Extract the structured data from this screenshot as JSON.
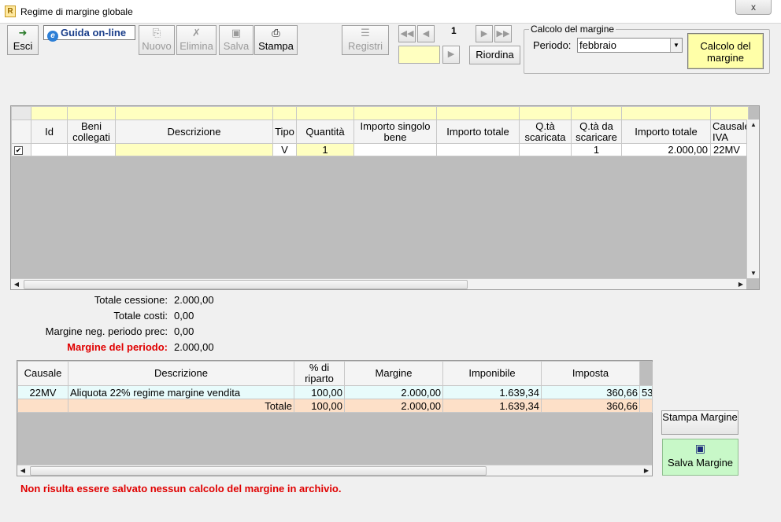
{
  "window": {
    "title": "Regime di margine globale",
    "app_icon": "R",
    "close_label": "x"
  },
  "toolbar": {
    "esci": "Esci",
    "guida": "Guida on-line",
    "nuovo": "Nuovo",
    "elimina": "Elimina",
    "salva": "Salva",
    "stampa": "Stampa",
    "registri": "Registri",
    "page_number": "1",
    "goto_value": "",
    "riordina": "Riordina"
  },
  "calcolo": {
    "title": "Calcolo del margine",
    "periodo_label": "Periodo:",
    "periodo_value": "febbraio",
    "button": "Calcolo del margine"
  },
  "grid": {
    "columns": [
      "Id",
      "Beni collegati",
      "Descrizione",
      "Tipo",
      "Quantità",
      "Importo singolo bene",
      "Importo totale",
      "Q.tà scaricata",
      "Q.tà da scaricare",
      "Importo totale",
      "Causale IVA"
    ],
    "rows": [
      {
        "checked": true,
        "id": "",
        "beni": "",
        "descrizione": "",
        "tipo": "V",
        "quantita": "1",
        "importo_singolo": "",
        "importo_totale": "",
        "qta_scaricata": "",
        "qta_da_scaricare": "1",
        "importo_totale2": "2.000,00",
        "causale": "22MV"
      }
    ]
  },
  "summary": {
    "totale_cessione_label": "Totale cessione:",
    "totale_cessione": "2.000,00",
    "totale_costi_label": "Totale costi:",
    "totale_costi": "0,00",
    "margine_neg_label": "Margine neg. periodo prec:",
    "margine_neg": "0,00",
    "margine_periodo_label": "Margine del periodo:",
    "margine_periodo": "2.000,00"
  },
  "grid2": {
    "columns": [
      "Causale",
      "Descrizione",
      "% di riparto",
      "Margine",
      "Imponibile",
      "Imposta"
    ],
    "rows": [
      {
        "causale": "22MV",
        "descrizione": "Aliquota 22% regime margine vendita",
        "riparto": "100,00",
        "margine": "2.000,00",
        "imponibile": "1.639,34",
        "imposta": "360,66",
        "extra": "53"
      }
    ],
    "total": {
      "label": "Totale",
      "riparto": "100,00",
      "margine": "2.000,00",
      "imponibile": "1.639,34",
      "imposta": "360,66"
    }
  },
  "side": {
    "stampa_margine": "Stampa Margine",
    "salva_margine": "Salva Margine"
  },
  "message": "Non risulta essere salvato nessun calcolo del margine in archivio."
}
